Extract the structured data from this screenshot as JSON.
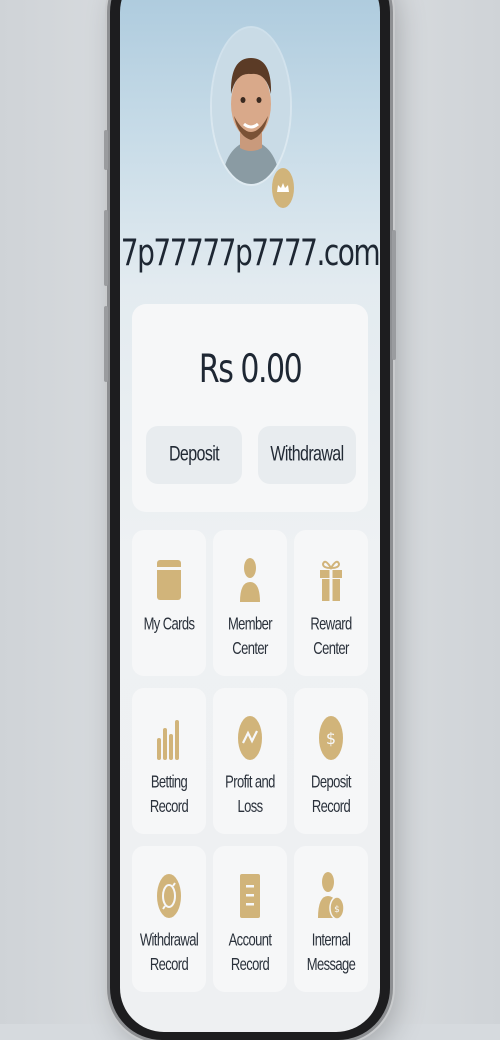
{
  "profile": {
    "username": "7p77777p7777.com",
    "avatar_icon": "user-photo",
    "badge_icon": "crown-icon"
  },
  "wallet": {
    "balance": "Rs 0.00",
    "deposit_label": "Deposit",
    "withdrawal_label": "Withdrawal"
  },
  "menu": {
    "items": [
      {
        "label": "My Cards",
        "icon": "card-icon"
      },
      {
        "label": "Member\nCenter",
        "icon": "person-icon"
      },
      {
        "label": "Reward\nCenter",
        "icon": "gift-icon"
      },
      {
        "label": "Betting\nRecord",
        "icon": "bars-icon"
      },
      {
        "label": "Profit and\nLoss",
        "icon": "trend-icon"
      },
      {
        "label": "Deposit\nRecord",
        "icon": "dollar-icon"
      },
      {
        "label": "Withdrawal\nRecord",
        "icon": "cycle-icon"
      },
      {
        "label": "Account\nRecord",
        "icon": "document-icon"
      },
      {
        "label": "Internal\nMessage",
        "icon": "user-dollar-icon"
      }
    ]
  },
  "colors": {
    "accent": "#d1b47a",
    "text": "#1e2733",
    "card": "#f6f7f8"
  }
}
